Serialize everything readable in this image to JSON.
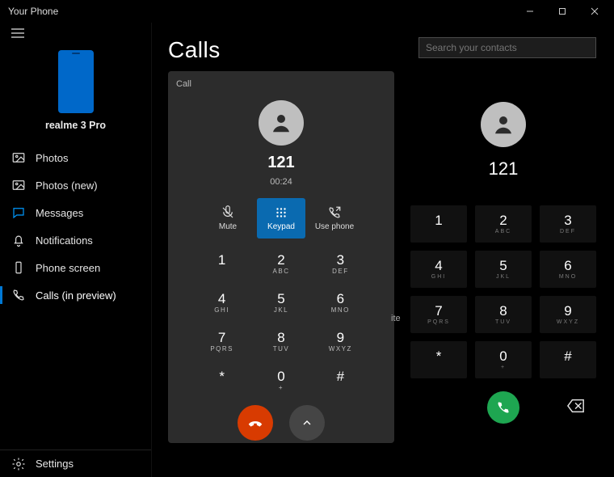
{
  "window": {
    "title": "Your Phone"
  },
  "device": {
    "name": "realme 3 Pro"
  },
  "sidebar": {
    "items": [
      {
        "label": "Photos",
        "icon": "image-icon"
      },
      {
        "label": "Photos (new)",
        "icon": "image-icon"
      },
      {
        "label": "Messages",
        "icon": "chat-icon"
      },
      {
        "label": "Notifications",
        "icon": "bell-icon"
      },
      {
        "label": "Phone screen",
        "icon": "screen-icon"
      },
      {
        "label": "Calls (in preview)",
        "icon": "phone-icon"
      }
    ],
    "settings_label": "Settings"
  },
  "calls": {
    "heading": "Calls",
    "card": {
      "tag": "Call",
      "number": "121",
      "timer": "00:24",
      "actions": {
        "mute": "Mute",
        "keypad": "Keypad",
        "usephone": "Use phone"
      },
      "stray_label": "ite"
    }
  },
  "dialer": {
    "search_placeholder": "Search your contacts",
    "number": "121"
  },
  "keypad": [
    {
      "d": "1",
      "s": ""
    },
    {
      "d": "2",
      "s": "ABC"
    },
    {
      "d": "3",
      "s": "DEF"
    },
    {
      "d": "4",
      "s": "GHI"
    },
    {
      "d": "5",
      "s": "JKL"
    },
    {
      "d": "6",
      "s": "MNO"
    },
    {
      "d": "7",
      "s": "PQRS"
    },
    {
      "d": "8",
      "s": "TUV"
    },
    {
      "d": "9",
      "s": "WXYZ"
    },
    {
      "d": "*",
      "s": ""
    },
    {
      "d": "0",
      "s": "+"
    },
    {
      "d": "#",
      "s": ""
    }
  ]
}
